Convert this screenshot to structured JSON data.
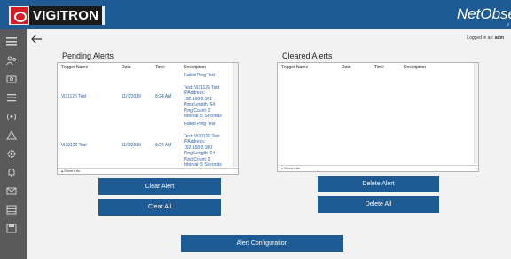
{
  "header": {
    "logo_text": "VIGITRON",
    "brand": "NetObse",
    "brand_sub": "v"
  },
  "sidebar": {
    "items": [
      {
        "icon": "menu-icon"
      },
      {
        "icon": "users-icon"
      },
      {
        "icon": "group-icon"
      },
      {
        "icon": "list-icon"
      },
      {
        "icon": "network-icon"
      },
      {
        "icon": "alert-triangle-icon"
      },
      {
        "icon": "gear-icon"
      },
      {
        "icon": "bell-icon"
      },
      {
        "icon": "mail-icon"
      },
      {
        "icon": "table-icon"
      },
      {
        "icon": "save-icon"
      }
    ]
  },
  "session": {
    "logged_label": "Logged in as:",
    "user": "adm"
  },
  "pending": {
    "title": "Pending Alerts",
    "columns": [
      "Trigger Name",
      "Date",
      "Time",
      "Description"
    ],
    "rows": [
      {
        "trigger": "",
        "date": "",
        "time": "",
        "description": [
          "Failed Ping Test"
        ]
      },
      {
        "trigger": "Vi31126 Test",
        "date": "11/1/2019",
        "time": "8:24 AM",
        "description": [
          "Test: Vi31126 Test",
          "IPAddress: 192.168.0.101",
          "Ping Length: 64",
          "Ping Count: 2",
          "Interval: 5 Seconds",
          "Failed Ping Test"
        ]
      },
      {
        "trigger": "Vi30126 Test",
        "date": "11/1/2019",
        "time": "8:24 AM",
        "description": [
          "Test: Vi30126 Test",
          "IPAddress: 192.168.0.100",
          "Ping Length: 64",
          "Ping Count: 2",
          "Interval: 5 Seconds"
        ]
      }
    ],
    "footer": "Show Info"
  },
  "cleared": {
    "title": "Cleared Alerts",
    "columns": [
      "Trigger Name",
      "Date",
      "Time",
      "Description"
    ],
    "footer": "Show Info"
  },
  "buttons": {
    "clear_alert": "Clear Alert",
    "clear_all": "Clear All",
    "delete_alert": "Delete Alert",
    "delete_all": "Delete All",
    "alert_configuration": "Alert Configuration"
  }
}
